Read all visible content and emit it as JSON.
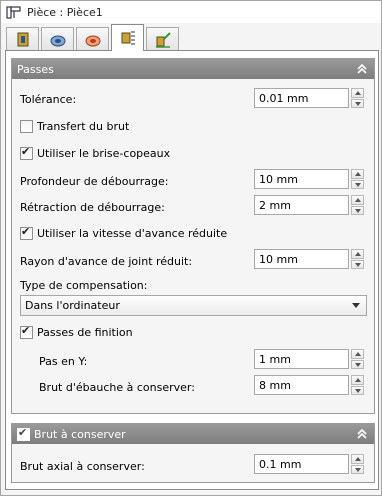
{
  "window": {
    "title": "Pièce : Pièce1"
  },
  "tabs": [
    {
      "name": "tool-tab",
      "icon": "tool-icon"
    },
    {
      "name": "geometry-tab",
      "icon": "geometry-icon"
    },
    {
      "name": "heights-tab",
      "icon": "heights-icon"
    },
    {
      "name": "passes-tab",
      "icon": "passes-icon",
      "active": true
    },
    {
      "name": "linking-tab",
      "icon": "linking-icon"
    }
  ],
  "passes": {
    "header": "Passes",
    "tolerance_label": "Tolérance:",
    "tolerance_value": "0.01 mm",
    "stock_transfer_label": "Transfert du brut",
    "stock_transfer_checked": false,
    "chip_breaking_label": "Utiliser le brise-copeaux",
    "chip_breaking_checked": true,
    "peck_depth_label": "Profondeur de débourrage:",
    "peck_depth_value": "10 mm",
    "peck_retract_label": "Rétraction de débourrage:",
    "peck_retract_value": "2 mm",
    "reduced_feed_label": "Utiliser la vitesse d'avance réduite",
    "reduced_feed_checked": true,
    "reduced_feed_radius_label": "Rayon d'avance de joint réduit:",
    "reduced_feed_radius_value": "10 mm",
    "compensation_label": "Type de compensation:",
    "compensation_value": "Dans l'ordinateur",
    "finishing_label": "Passes de finition",
    "finishing_checked": true,
    "y_step_label": "Pas en Y:",
    "y_step_value": "1 mm",
    "rough_stock_label": "Brut d'ébauche à conserver:",
    "rough_stock_value": "8 mm"
  },
  "stock": {
    "header": "Brut à conserver",
    "checked": true,
    "axial_label": "Brut axial à conserver:",
    "axial_value": "0.1 mm"
  }
}
